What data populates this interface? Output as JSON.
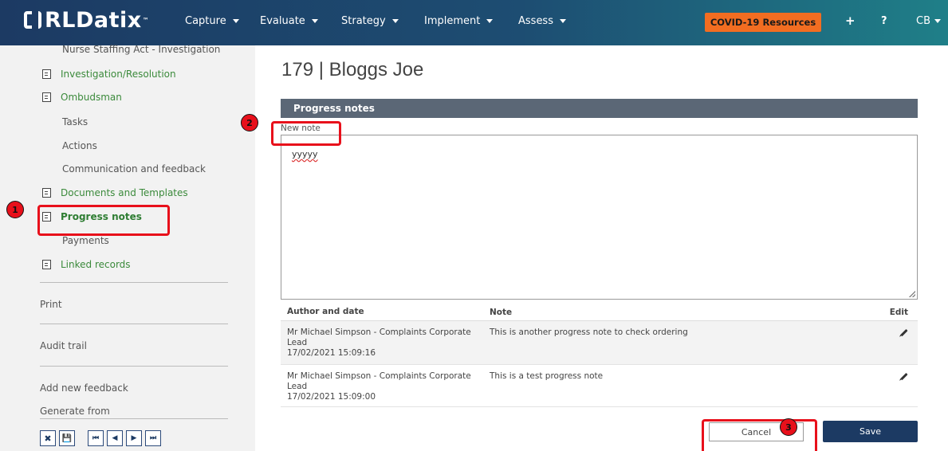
{
  "brand": {
    "logo_text": "RLDatix",
    "trademark": "™"
  },
  "nav": {
    "items": [
      {
        "label": "Capture"
      },
      {
        "label": "Evaluate"
      },
      {
        "label": "Strategy"
      },
      {
        "label": "Implement"
      },
      {
        "label": "Assess"
      }
    ],
    "covid_label": "COVID-19 Resources",
    "plus_icon": "+",
    "help_icon": "?",
    "user_initials": "CB"
  },
  "sidebar": {
    "items": [
      {
        "label": "Nurse Staffing Act - Investigation"
      },
      {
        "label": "Investigation/Resolution"
      },
      {
        "label": "Ombudsman"
      },
      {
        "label": "Tasks"
      },
      {
        "label": "Actions"
      },
      {
        "label": "Communication and feedback"
      },
      {
        "label": "Documents and Templates"
      },
      {
        "label": "Progress notes"
      },
      {
        "label": "Payments"
      },
      {
        "label": "Linked records"
      }
    ],
    "print": "Print",
    "audit_trail": "Audit trail",
    "add_feedback": "Add new feedback",
    "generate_from": "Generate from"
  },
  "toolbar": {
    "close_icon": "✖",
    "save_icon": "💾",
    "first_icon": "⏮",
    "prev_icon": "◀",
    "next_icon": "▶",
    "last_icon": "⏭"
  },
  "main": {
    "title": "179 | Bloggs Joe",
    "panel_title": "Progress notes",
    "new_note_label": "New note",
    "new_note_value": "yyyyy",
    "table": {
      "headers": {
        "author": "Author and date",
        "note": "Note",
        "edit": "Edit"
      },
      "rows": [
        {
          "author": "Mr Michael Simpson - Complaints Corporate Lead",
          "date": "17/02/2021 15:09:16",
          "note": "This is another progress note to check ordering"
        },
        {
          "author": "Mr Michael Simpson - Complaints Corporate Lead",
          "date": "17/02/2021 15:09:00",
          "note": "This is a test progress note"
        }
      ]
    },
    "cancel_label": "Cancel",
    "save_label": "Save"
  },
  "annotations": {
    "step1": "1",
    "step2": "2",
    "step3": "3"
  },
  "colors": {
    "accent_red": "#e8101b",
    "nav_dark": "#1c3a63",
    "covid_orange": "#f26d21",
    "save_blue": "#1c3a63",
    "panel_header": "#5b6776"
  }
}
